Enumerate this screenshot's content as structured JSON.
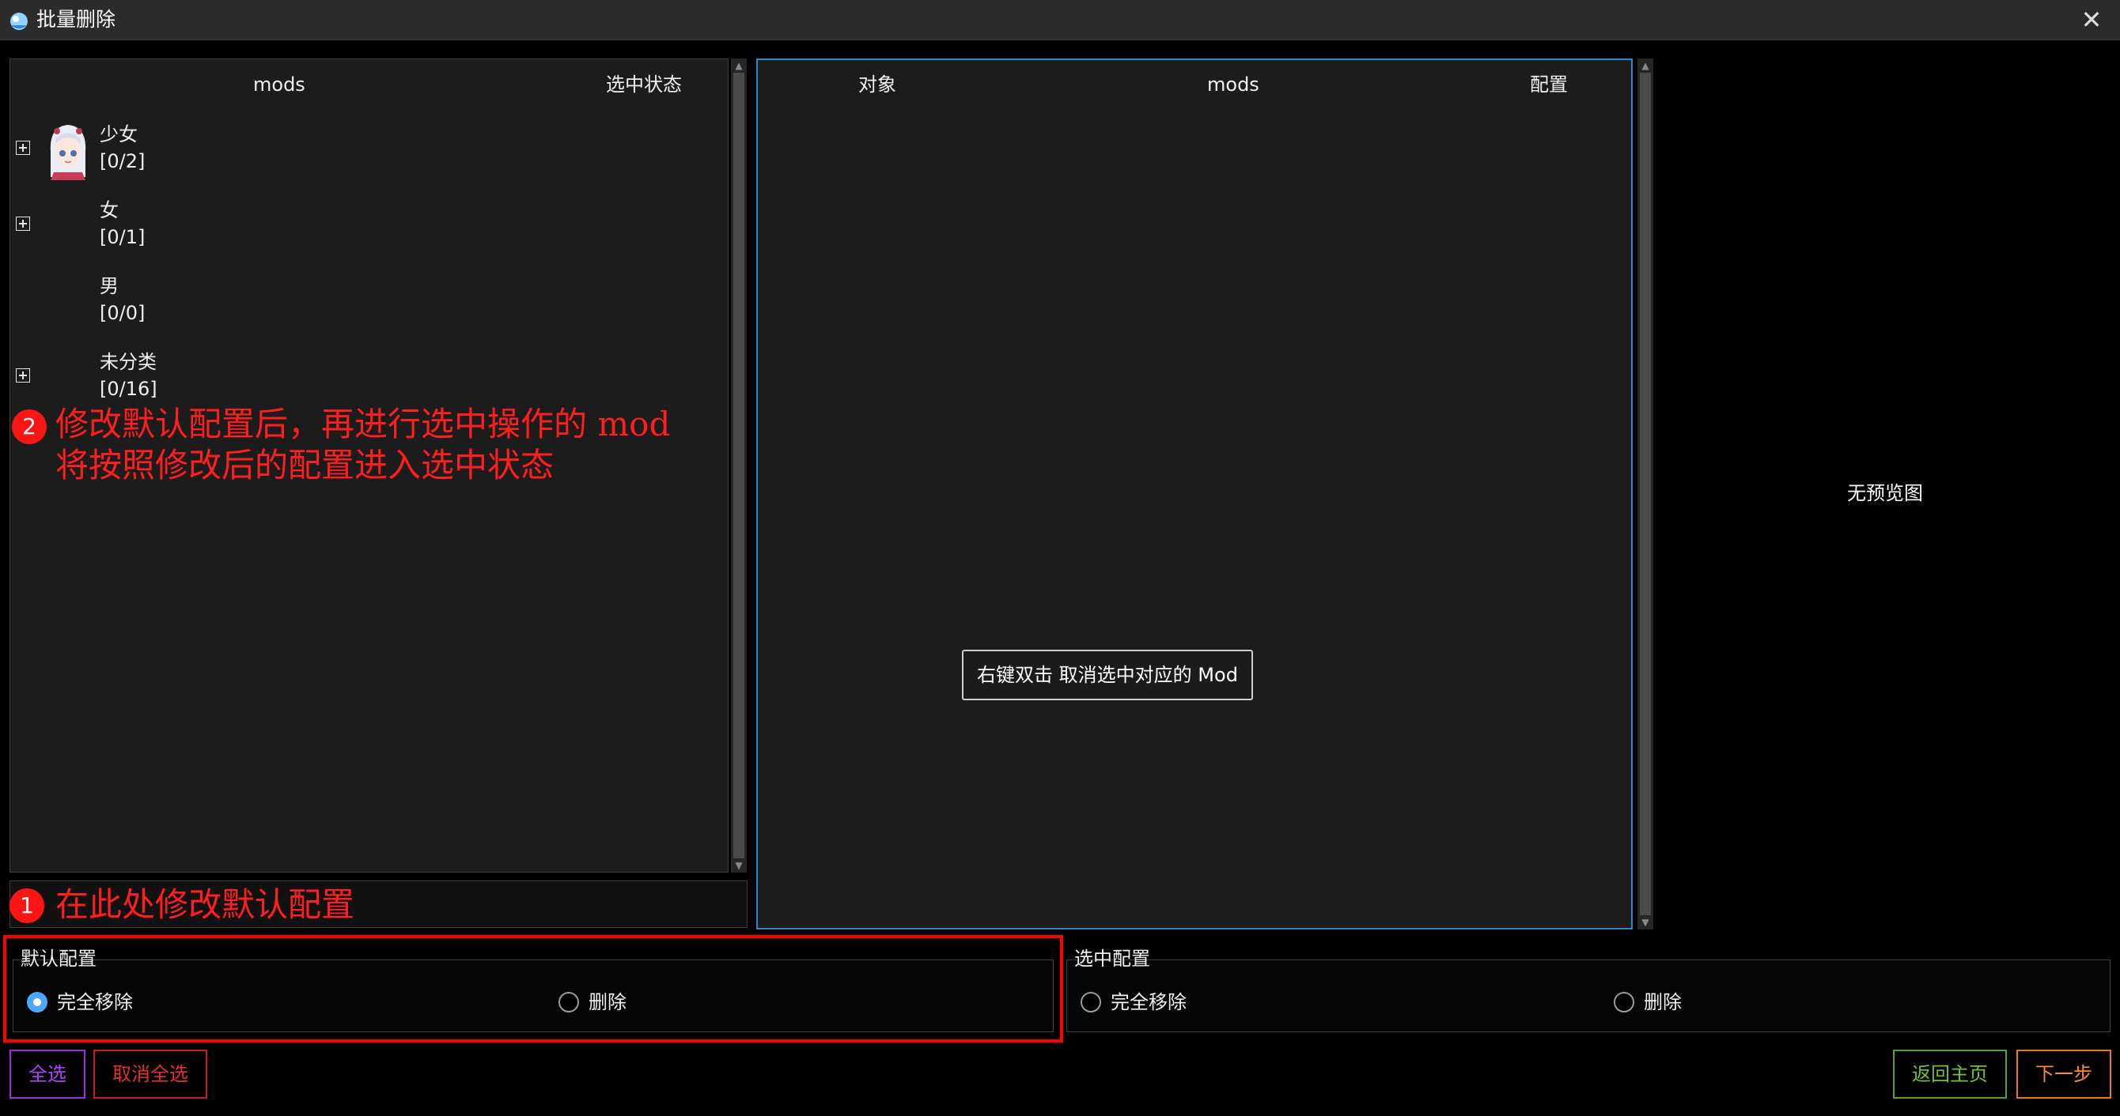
{
  "window": {
    "title": "批量删除",
    "close_glyph": "✕",
    "icon": "app-icon"
  },
  "left_table": {
    "headers": {
      "mods": "mods",
      "state": "选中状态"
    },
    "groups": [
      {
        "label": "少女",
        "count": "[0/2]",
        "expandable": true,
        "has_avatar": true
      },
      {
        "label": "女",
        "count": "[0/1]",
        "expandable": true
      },
      {
        "label": "男",
        "count": "[0/0]",
        "expandable": false
      },
      {
        "label": "未分类",
        "count": "[0/16]",
        "expandable": true
      }
    ]
  },
  "right_table": {
    "headers": {
      "object": "对象",
      "mods": "mods",
      "config": "配置"
    },
    "hint": "右键双击 取消选中对应的 Mod"
  },
  "preview": {
    "empty_text": "无预览图"
  },
  "annotations": {
    "one": {
      "badge": "1",
      "text": "在此处修改默认配置"
    },
    "two": {
      "badge": "2",
      "line1": "修改默认配置后，再进行选中操作的 mod",
      "line2": "将按照修改后的配置进入选中状态"
    },
    "color": "#ff1e1e"
  },
  "default_config": {
    "title": "默认配置",
    "options": [
      {
        "label": "完全移除",
        "selected": true
      },
      {
        "label": "删除",
        "selected": false
      }
    ]
  },
  "selected_config": {
    "title": "选中配置",
    "options": [
      {
        "label": "完全移除",
        "selected": false
      },
      {
        "label": "删除",
        "selected": false
      }
    ]
  },
  "buttons": {
    "select_all": "全选",
    "deselect_all": "取消全选",
    "home": "返回主页",
    "next": "下一步"
  },
  "colors": {
    "accent": "#4aa8ff",
    "select_all": "#b040ff",
    "deselect_all": "#e03030",
    "home": "#6fc23a",
    "next": "#ff8a2a"
  }
}
